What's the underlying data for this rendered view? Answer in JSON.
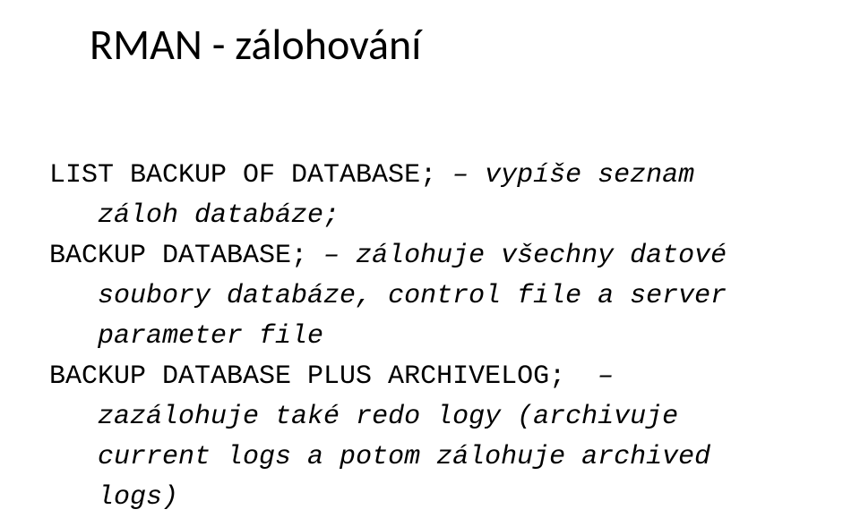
{
  "title": "RMAN - zálohování",
  "lines": [
    {
      "code": "LIST BACKUP OF DATABASE; ",
      "desc": "– vypíše seznam"
    },
    {
      "code": "   ",
      "desc": "záloh databáze;"
    },
    {
      "code": "BACKUP DATABASE; ",
      "desc": "– zálohuje všechny datové"
    },
    {
      "code": "   ",
      "desc": "soubory databáze, control file a server"
    },
    {
      "code": "   ",
      "desc": "parameter file"
    },
    {
      "code": "BACKUP DATABASE PLUS ARCHIVELOG;  ",
      "desc": "–"
    },
    {
      "code": "   ",
      "desc": "zazálohuje také redo logy (archivuje"
    },
    {
      "code": "   ",
      "desc": "current logs a potom zálohuje archived"
    },
    {
      "code": "   ",
      "desc": "logs)"
    }
  ]
}
